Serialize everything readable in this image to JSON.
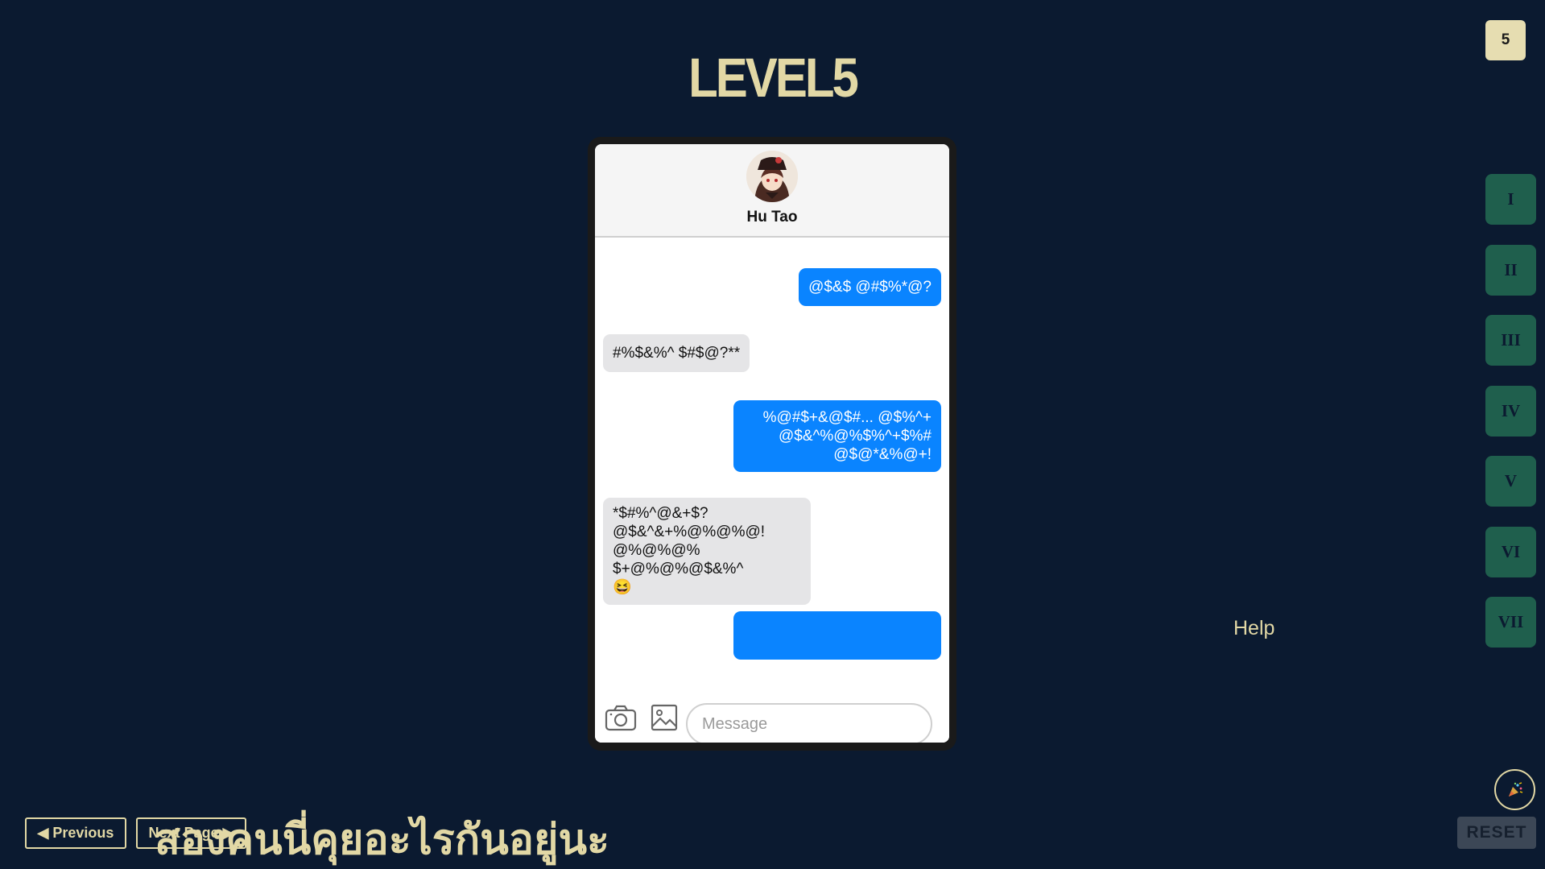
{
  "level": {
    "title": "LEVEL5",
    "counter": "5"
  },
  "level_nav": [
    "I",
    "II",
    "III",
    "IV",
    "V",
    "VI",
    "VII"
  ],
  "help_label": "Help",
  "reset_label": "RESET",
  "confetti_icon": "party-popper-icon",
  "chat": {
    "contact_name": "Hu Tao",
    "messages": [
      {
        "side": "sent",
        "lines": [
          "@$&$ @#$%*@?"
        ]
      },
      {
        "side": "recv",
        "lines": [
          "#%$&%^ $#$@?**"
        ]
      },
      {
        "side": "sent",
        "lines": [
          "%@#$+&@$#... @$%^+",
          "@$&^%@%$%^+$%#",
          "@$@*&%@+!"
        ]
      },
      {
        "side": "recv",
        "lines": [
          "*$#%^@&+$?",
          "@$&^&+%@%@%@!",
          "@%@%@% $+@%@%@$&%^",
          "😆"
        ]
      }
    ],
    "composer": {
      "placeholder": "Message",
      "camera_icon": "camera-icon",
      "image_icon": "image-icon"
    }
  },
  "nav": {
    "previous_label": "◀ Previous",
    "next_label": "Next Page ▶"
  },
  "hint_text": "สองคนนี่คุยอะไรกันอยู่นะ",
  "colors": {
    "background": "#0b1a30",
    "accent_text": "#e2d8a5",
    "level_button": "#1f5f4d",
    "sent_bubble": "#0a84ff",
    "recv_bubble": "#e5e5e7"
  }
}
